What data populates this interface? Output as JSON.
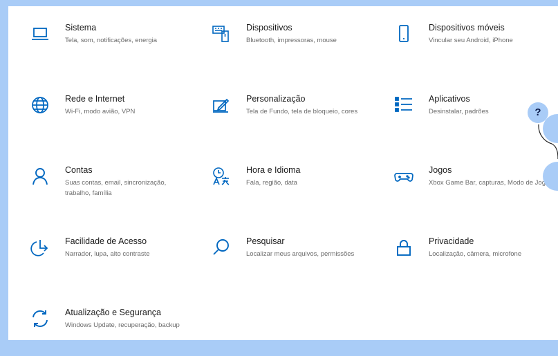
{
  "accent_color": "#0067c0",
  "help_icon_text": "?",
  "items": [
    {
      "id": "sistema",
      "title": "Sistema",
      "desc": "Tela, som, notificações, energia",
      "icon": "laptop-icon"
    },
    {
      "id": "dispositivos",
      "title": "Dispositivos",
      "desc": "Bluetooth, impressoras, mouse",
      "icon": "keyboard-icon"
    },
    {
      "id": "dispositivos-moveis",
      "title": "Dispositivos móveis",
      "desc": "Vincular seu Android, iPhone",
      "icon": "phone-icon"
    },
    {
      "id": "rede",
      "title": "Rede e Internet",
      "desc": "Wi-Fi, modo avião, VPN",
      "icon": "globe-icon"
    },
    {
      "id": "personalizacao",
      "title": "Personalização",
      "desc": "Tela de Fundo, tela de bloqueio, cores",
      "icon": "paint-icon"
    },
    {
      "id": "aplicativos",
      "title": "Aplicativos",
      "desc": "Desinstalar, padrões",
      "icon": "apps-list-icon"
    },
    {
      "id": "contas",
      "title": "Contas",
      "desc": "Suas contas, email, sincronização, trabalho, família",
      "icon": "person-icon"
    },
    {
      "id": "hora",
      "title": "Hora e Idioma",
      "desc": "Fala, região, data",
      "icon": "time-language-icon"
    },
    {
      "id": "jogos",
      "title": "Jogos",
      "desc": "Xbox Game Bar, capturas, Modo de Jogo",
      "icon": "gamepad-icon"
    },
    {
      "id": "facilidade",
      "title": "Facilidade de Acesso",
      "desc": "Narrador, lupa, alto contraste",
      "icon": "ease-of-access-icon"
    },
    {
      "id": "pesquisar",
      "title": "Pesquisar",
      "desc": "Localizar meus arquivos, permissões",
      "icon": "search-icon"
    },
    {
      "id": "privacidade",
      "title": "Privacidade",
      "desc": "Localização, câmera, microfone",
      "icon": "lock-icon"
    },
    {
      "id": "atualizacao",
      "title": "Atualização e Segurança",
      "desc": "Windows Update, recuperação, backup",
      "icon": "update-icon"
    }
  ]
}
